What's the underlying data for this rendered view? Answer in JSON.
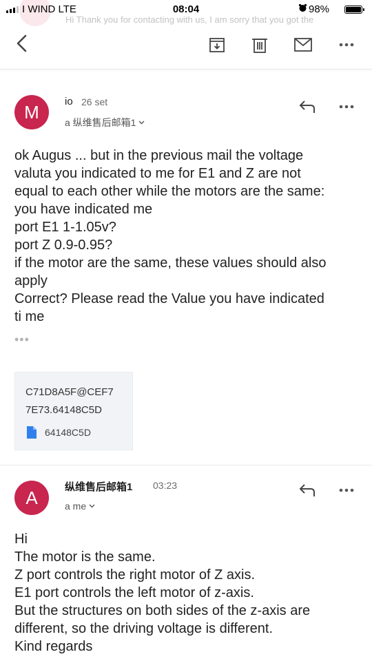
{
  "status_bar": {
    "carrier": "I WIND  LTE",
    "time": "08:04",
    "battery_percent": "98%",
    "battery_level": 0.98
  },
  "background_preview": {
    "text": "Hi Thank you for contacting with us, I am sorry that you got the"
  },
  "toolbar": {
    "back": "back-icon",
    "move": "move-to-icon",
    "delete": "trash-icon",
    "mark": "mail-icon",
    "more": "more-icon"
  },
  "messages": [
    {
      "avatar_letter": "M",
      "avatar_color": "#c8254f",
      "sender": "io",
      "date": "26 set",
      "recipient": "a 纵维售后邮箱1",
      "body": "ok Augus ... but in the previous mail the voltage\nvaluta you indicated to me for E1 and Z are not\nequal to each other while the motors are the same:\nyou have indicated me\nport E1 1-1.05v?\nport Z 0.9-0.95?\nif the motor are the same, these values should also\napply\nCorrect? Please read the Value you have indicated\nti me",
      "quoted_indicator": "•••",
      "attachment": {
        "line1": "C71D8A5F@CEF7",
        "line2": "7E73.64148C5D",
        "file_name": "64148C5D"
      }
    },
    {
      "avatar_letter": "A",
      "avatar_color": "#c8254f",
      "sender": "纵维售后邮箱1",
      "date": "03:23",
      "recipient": "a me",
      "body": "Hi\nThe motor is the same.\nZ port controls the right motor of Z axis.\nE1 port controls the left motor of z-axis.\nBut the structures on both sides of the z-axis are\ndifferent, so the driving voltage is different.\nKind regards"
    }
  ]
}
